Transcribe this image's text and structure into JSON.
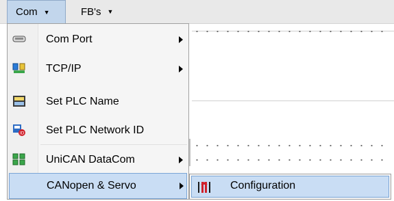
{
  "menubar": {
    "items": [
      {
        "label": "Com",
        "icon": "chevron-down-icon"
      },
      {
        "label": "FB's",
        "icon": "chevron-down-icon"
      }
    ]
  },
  "com_menu": {
    "items": [
      {
        "label": "Com Port",
        "icon": "serial-port-icon",
        "has_submenu": true
      },
      {
        "label": "TCP/IP",
        "icon": "network-icon",
        "has_submenu": true
      },
      {
        "label": "Set PLC Name",
        "icon": "plc-name-icon",
        "has_submenu": false
      },
      {
        "label": "Set PLC Network ID",
        "icon": "network-id-icon",
        "has_submenu": false
      },
      {
        "label": "UniCAN DataCom",
        "icon": "unican-icon",
        "has_submenu": true
      },
      {
        "label": "CANopen & Servo",
        "icon": "",
        "has_submenu": true,
        "highlighted": true
      }
    ]
  },
  "submenu": {
    "items": [
      {
        "label": "Configuration",
        "icon": "configuration-icon",
        "highlighted": true
      }
    ]
  },
  "colors": {
    "highlight": "#c9ddf4",
    "highlight_border": "#7aa5d6",
    "menubar": "#e9e9e9",
    "icon_red": "#d0202a"
  }
}
